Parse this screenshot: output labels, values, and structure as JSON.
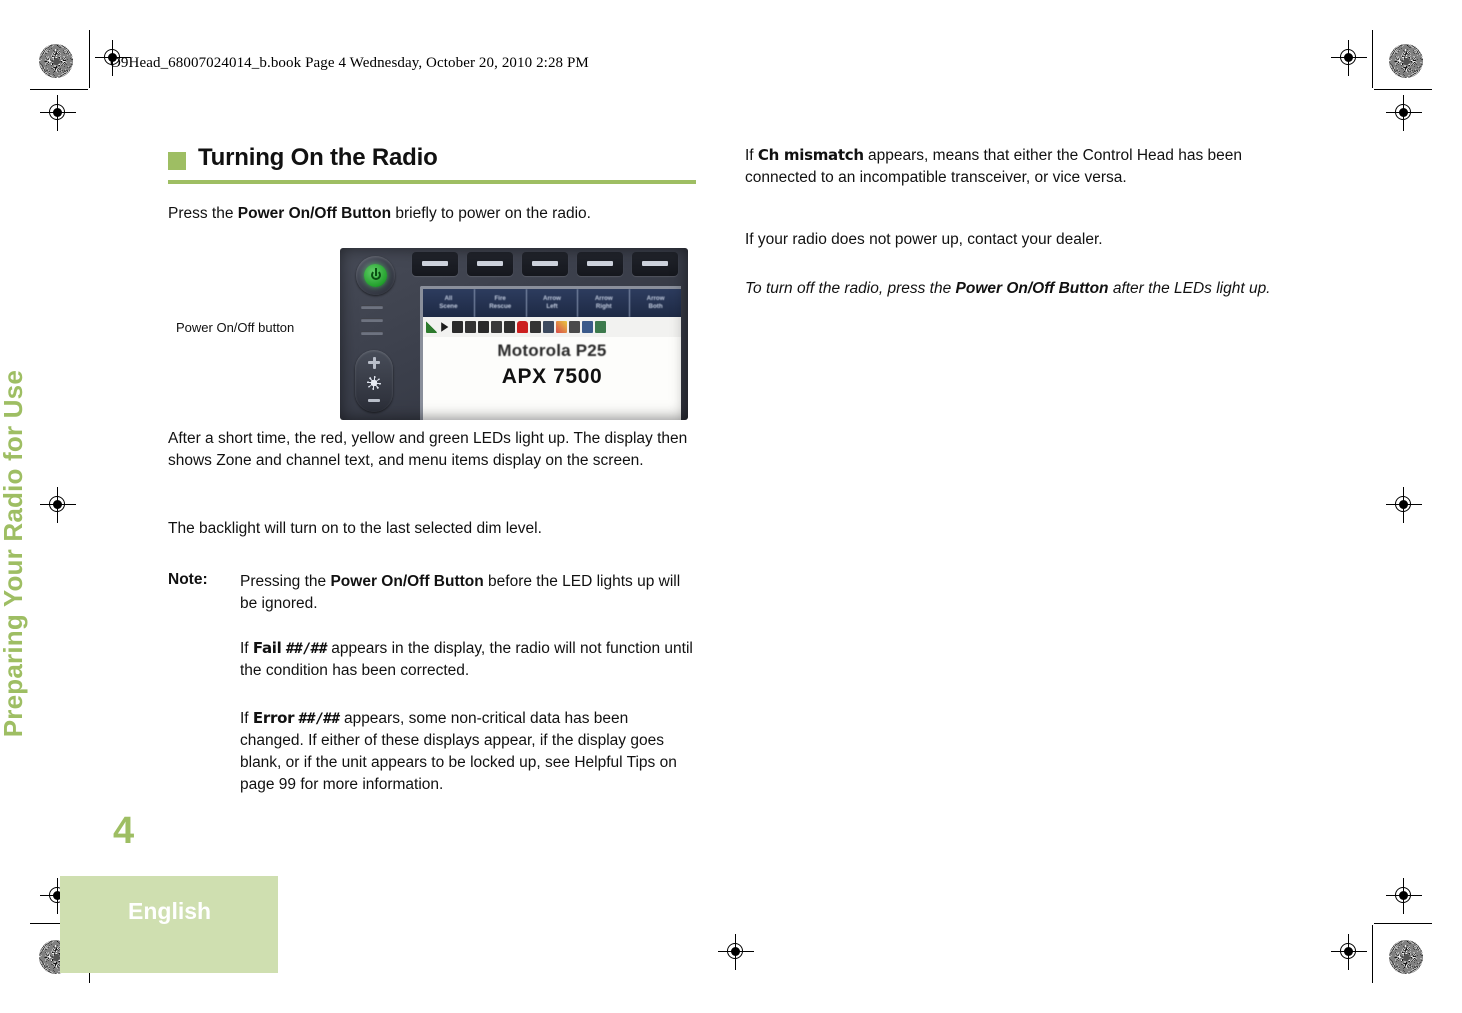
{
  "header": {
    "slug": "O9Head_68007024014_b.book  Page 4  Wednesday, October 20, 2010  2:28 PM"
  },
  "running_head": "Preparing Your Radio for Use",
  "page_number": "4",
  "language": "English",
  "colors": {
    "accent_green": "#9ebe63",
    "block_green": "#cfdfb0",
    "callout_green": "#7fa83f",
    "text": "#111111"
  },
  "section": {
    "heading": "Turning On the Radio",
    "intro": {
      "before": "Press the ",
      "bold": "Power On/Off Button",
      "after": " briefly to power on the radio."
    }
  },
  "figure": {
    "callout_label": "Power On/Off button",
    "radio": {
      "softkeys": [
        "All\nScene",
        "Fire\nRescue",
        "Arrow\nLeft",
        "Arrow\nRight",
        "Arrow\nBoth"
      ],
      "display_name": "Motorola P25",
      "display_model": "APX 7500",
      "led_count": 3,
      "top_key_count": 5,
      "rocker_labels": [
        "+",
        "brightness",
        "-"
      ]
    }
  },
  "left_column": {
    "para_leds": "After a short time, the red, yellow and green LEDs light up. The display then shows Zone and channel text, and menu items display on the screen.",
    "para_backlight": "The backlight will turn on to the last selected dim level.",
    "note_label": "Note:",
    "note_body": {
      "before": "Pressing the ",
      "bold": "Power On/Off Button",
      "after": " before the LED lights up will be ignored."
    },
    "fail_para": {
      "before": "If ",
      "disp": "Fail",
      "hash": "##/##",
      "after": " appears in the display, the radio will not function until the condition has been corrected."
    },
    "error_para": {
      "before": "If ",
      "disp": "Error",
      "hash": "##/##",
      "after": " appears, some non-critical data has been changed. If either of these displays appear, if the display goes blank, or if the unit appears to be locked up, see Helpful Tips on page 99 for more information."
    }
  },
  "right_column": {
    "mismatch_para": {
      "before": "If ",
      "disp": "Ch mismatch",
      "after": " appears, means that either the Control Head has been connected to an incompatible transceiver, or vice versa."
    },
    "dealer_para": "If your radio does not power up, contact your dealer.",
    "turnoff_para": {
      "before": "To turn off the radio, press the ",
      "bold": "Power On/Off Button",
      "after": " after the LEDs light up."
    }
  }
}
